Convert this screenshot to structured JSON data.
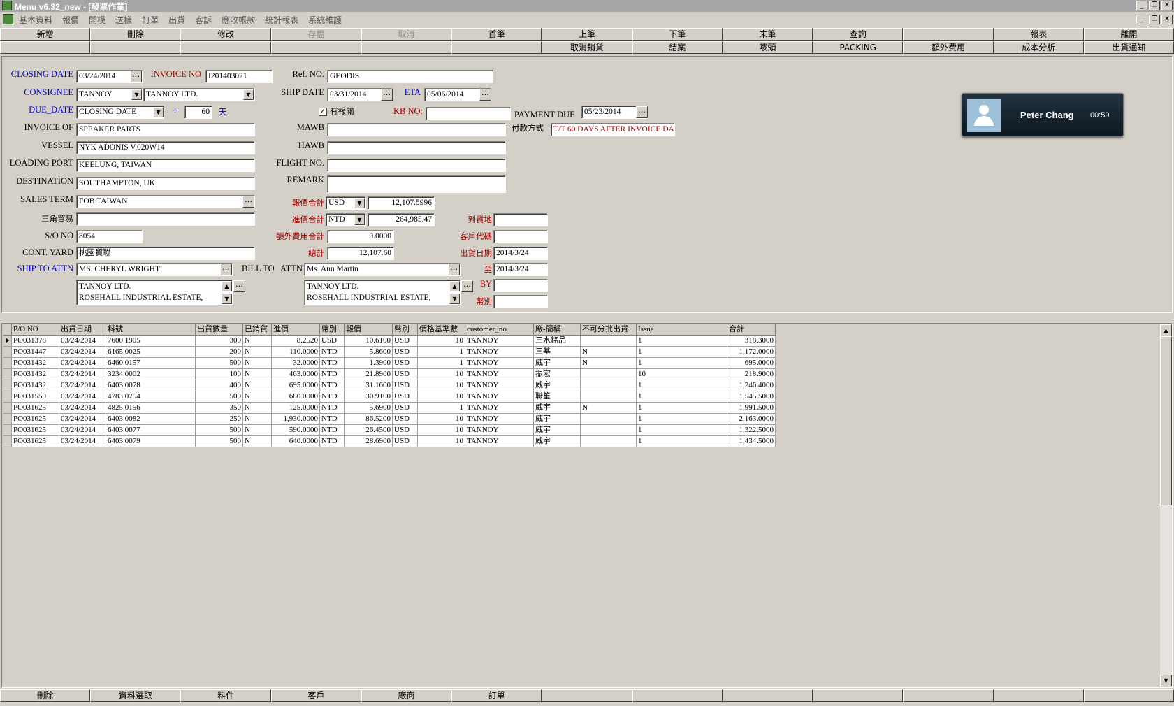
{
  "window": {
    "title": "Menu v6.32_new - [發票作業]"
  },
  "menu": [
    "基本資料",
    "報價",
    "開模",
    "送樣",
    "訂單",
    "出貨",
    "客訴",
    "應收帳款",
    "統計報表",
    "系統維護"
  ],
  "toolbar_row1": [
    {
      "label": "新增",
      "enabled": true
    },
    {
      "label": "刪除",
      "enabled": true
    },
    {
      "label": "修改",
      "enabled": true
    },
    {
      "label": "存檔",
      "enabled": false
    },
    {
      "label": "取消",
      "enabled": false
    },
    {
      "label": "首筆",
      "enabled": true
    },
    {
      "label": "上筆",
      "enabled": true
    },
    {
      "label": "下筆",
      "enabled": true
    },
    {
      "label": "末筆",
      "enabled": true
    },
    {
      "label": "查詢",
      "enabled": true
    },
    {
      "label": "",
      "enabled": true
    },
    {
      "label": "報表",
      "enabled": true
    },
    {
      "label": "離開",
      "enabled": true
    }
  ],
  "toolbar_row2": [
    "",
    "",
    "",
    "",
    "",
    "",
    "取消銷貨",
    "結案",
    "嘜頭",
    "PACKING",
    "額外費用",
    "成本分析",
    "出貨通知"
  ],
  "form": {
    "closing_date": {
      "label": "CLOSING DATE",
      "value": "03/24/2014"
    },
    "invoice_no": {
      "label": "INVOICE NO",
      "value": "I201403021"
    },
    "ref_no": {
      "label": "Ref. NO.",
      "value": "GEODIS"
    },
    "consignee": {
      "label": "CONSIGNEE",
      "code": "TANNOY",
      "name": "TANNOY LTD."
    },
    "ship_date": {
      "label": "SHIP DATE",
      "value": "03/31/2014"
    },
    "eta": {
      "label": "ETA",
      "value": "05/06/2014"
    },
    "due_date": {
      "label": "DUE_DATE",
      "value": "CLOSING DATE",
      "plus": "+",
      "days": "60",
      "unit": "天"
    },
    "has_customs": {
      "label": "有報關",
      "checked": true
    },
    "kb_no": {
      "label": "KB NO:",
      "value": ""
    },
    "payment_due": {
      "label": "PAYMENT DUE",
      "value": "05/23/2014"
    },
    "invoice_of": {
      "label": "INVOICE OF",
      "value": "SPEAKER PARTS"
    },
    "mawb": {
      "label": "MAWB",
      "value": ""
    },
    "payment_method": {
      "label": "付款方式",
      "value": "T/T 60 DAYS AFTER INVOICE DA"
    },
    "vessel": {
      "label": "VESSEL",
      "value": "NYK ADONIS V.020W14"
    },
    "hawb": {
      "label": "HAWB",
      "value": ""
    },
    "loading_port": {
      "label": "LOADING PORT",
      "value": "KEELUNG, TAIWAN"
    },
    "flight_no": {
      "label": "FLIGHT NO.",
      "value": ""
    },
    "destination": {
      "label": "DESTINATION",
      "value": "SOUTHAMPTON, UK"
    },
    "remark": {
      "label": "REMARK",
      "value": ""
    },
    "sales_term": {
      "label": "SALES TERM",
      "value": "FOB TAIWAN"
    },
    "quote_total": {
      "label": "報價合計",
      "currency": "USD",
      "value": "12,107.5996"
    },
    "triangle_trade": {
      "label": "三角貿易",
      "value": ""
    },
    "cost_total": {
      "label": "進價合計",
      "currency": "NTD",
      "value": "264,985.47"
    },
    "arrival_place": {
      "label": "到貨地",
      "value": ""
    },
    "so_no": {
      "label": "S/O NO",
      "value": "8054"
    },
    "extra_fee_total": {
      "label": "額外費用合計",
      "value": "0.0000"
    },
    "customer_code": {
      "label": "客戶代碼",
      "value": ""
    },
    "cont_yard": {
      "label": "CONT. YARD",
      "value": "桃園貿聯"
    },
    "grand_total": {
      "label": "總計",
      "value": "12,107.60"
    },
    "ship_date_from": {
      "label": "出貨日期",
      "value": "2014/3/24"
    },
    "ship_to_attn": {
      "label": "SHIP TO  ATTN",
      "value": "MS. CHERYL WRIGHT"
    },
    "bill_to": {
      "label": "BILL TO",
      "attn_label": "ATTN",
      "value": "Ms. Ann Martin"
    },
    "ship_date_to": {
      "label": "至",
      "value": "2014/3/24"
    },
    "ship_to_address": "TANNOY LTD.\nROSEHALL INDUSTRIAL ESTATE,",
    "bill_to_address": "TANNOY LTD.\nROSEHALL INDUSTRIAL ESTATE,",
    "by": {
      "label": "BY",
      "value": ""
    },
    "currency": {
      "label": "幣別",
      "value": ""
    }
  },
  "call": {
    "name": "Peter Chang",
    "time": "00:59"
  },
  "grid": {
    "columns": [
      "P/O NO",
      "出貨日期",
      "料號",
      "出貨數量",
      "已銷貨",
      "進價",
      "幣別",
      "報價",
      "幣別",
      "價格基準數",
      "customer_no",
      "廠-簡稱",
      "不可分批出貨",
      "Issue",
      "合計"
    ],
    "rows": [
      [
        "PO031378",
        "03/24/2014",
        "7600 1905",
        "300",
        "N",
        "8.2520",
        "USD",
        "10.6100",
        "USD",
        "10",
        "TANNOY",
        "三水銘品",
        "",
        "1",
        "318.3000"
      ],
      [
        "PO031447",
        "03/24/2014",
        "6165 0025",
        "200",
        "N",
        "110.0000",
        "NTD",
        "5.8600",
        "USD",
        "1",
        "TANNOY",
        "三基",
        "N",
        "1",
        "1,172.0000"
      ],
      [
        "PO031432",
        "03/24/2014",
        "6460 0157",
        "500",
        "N",
        "32.0000",
        "NTD",
        "1.3900",
        "USD",
        "1",
        "TANNOY",
        "威宇",
        "N",
        "1",
        "695.0000"
      ],
      [
        "PO031432",
        "03/24/2014",
        "3234 0002",
        "100",
        "N",
        "463.0000",
        "NTD",
        "21.8900",
        "USD",
        "10",
        "TANNOY",
        "振宏",
        "",
        "10",
        "218.9000"
      ],
      [
        "PO031432",
        "03/24/2014",
        "6403 0078",
        "400",
        "N",
        "695.0000",
        "NTD",
        "31.1600",
        "USD",
        "10",
        "TANNOY",
        "威宇",
        "",
        "1",
        "1,246.4000"
      ],
      [
        "PO031559",
        "03/24/2014",
        "4783 0754",
        "500",
        "N",
        "680.0000",
        "NTD",
        "30.9100",
        "USD",
        "10",
        "TANNOY",
        "聯笙",
        "",
        "1",
        "1,545.5000"
      ],
      [
        "PO031625",
        "03/24/2014",
        "4825 0156",
        "350",
        "N",
        "125.0000",
        "NTD",
        "5.6900",
        "USD",
        "1",
        "TANNOY",
        "威宇",
        "N",
        "1",
        "1,991.5000"
      ],
      [
        "PO031625",
        "03/24/2014",
        "6403 0082",
        "250",
        "N",
        "1,930.0000",
        "NTD",
        "86.5200",
        "USD",
        "10",
        "TANNOY",
        "威宇",
        "",
        "1",
        "2,163.0000"
      ],
      [
        "PO031625",
        "03/24/2014",
        "6403 0077",
        "500",
        "N",
        "590.0000",
        "NTD",
        "26.4500",
        "USD",
        "10",
        "TANNOY",
        "威宇",
        "",
        "1",
        "1,322.5000"
      ],
      [
        "PO031625",
        "03/24/2014",
        "6403 0079",
        "500",
        "N",
        "640.0000",
        "NTD",
        "28.6900",
        "USD",
        "10",
        "TANNOY",
        "威宇",
        "",
        "1",
        "1,434.5000"
      ]
    ]
  },
  "bottom_buttons": [
    "刪除",
    "資料選取",
    "料件",
    "客戶",
    "廠商",
    "訂單",
    "",
    "",
    "",
    "",
    "",
    "",
    ""
  ]
}
